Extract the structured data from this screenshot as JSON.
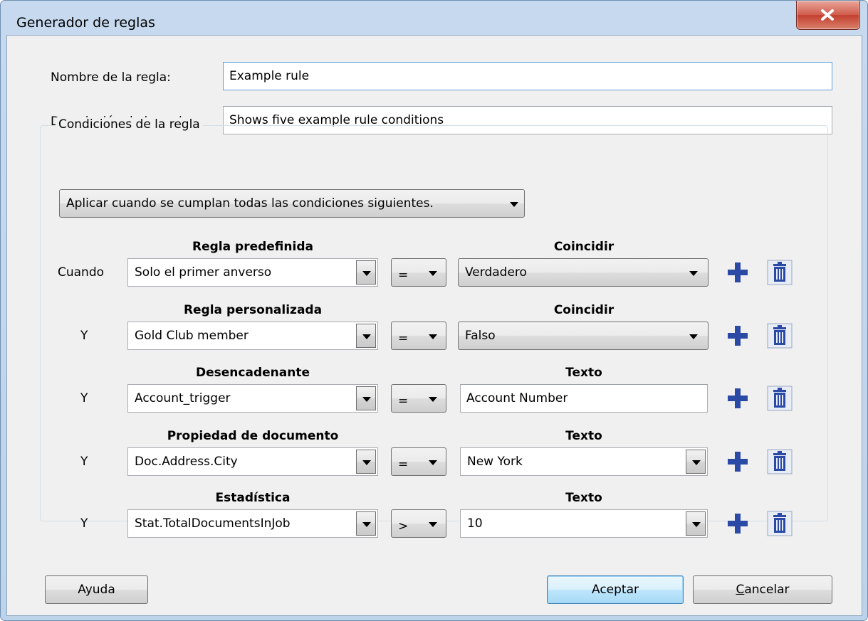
{
  "window": {
    "title": "Generador de reglas",
    "close_icon": "close-icon"
  },
  "form": {
    "name_label": "Nombre de la regla:",
    "name_value": "Example rule",
    "desc_label": "Descripción de la regla:",
    "desc_value": "Shows five example rule conditions"
  },
  "conditions": {
    "group_label": "Condiciones de la regla",
    "apply_mode": "Aplicar cuando se cumplan todas las condiciones siguientes.",
    "rows": [
      {
        "connector": "Cuando",
        "left_header": "Regla predefinida",
        "left_value": "Solo el primer anverso",
        "operator": "=",
        "right_header": "Coincidir",
        "right_value": "Verdadero",
        "right_kind": "dropdown"
      },
      {
        "connector": "Y",
        "left_header": "Regla personalizada",
        "left_value": "Gold Club member",
        "operator": "=",
        "right_header": "Coincidir",
        "right_value": "Falso",
        "right_kind": "dropdown"
      },
      {
        "connector": "Y",
        "left_header": "Desencadenante",
        "left_value": "Account_trigger",
        "operator": "=",
        "right_header": "Texto",
        "right_value": "Account Number",
        "right_kind": "text"
      },
      {
        "connector": "Y",
        "left_header": "Propiedad de documento",
        "left_value": "Doc.Address.City",
        "operator": "=",
        "right_header": "Texto",
        "right_value": "New York",
        "right_kind": "combo"
      },
      {
        "connector": "Y",
        "left_header": "Estadística",
        "left_value": "Stat.TotalDocumentsInJob",
        "operator": ">",
        "right_header": "Texto",
        "right_value": "10",
        "right_kind": "combo"
      }
    ]
  },
  "buttons": {
    "help": "Ayuda",
    "ok": "Aceptar",
    "cancel": "Cancelar"
  },
  "colors": {
    "accent_icon": "#2b4aa6",
    "title_bar": "#c6d9ee",
    "close_button": "#c3402f"
  }
}
